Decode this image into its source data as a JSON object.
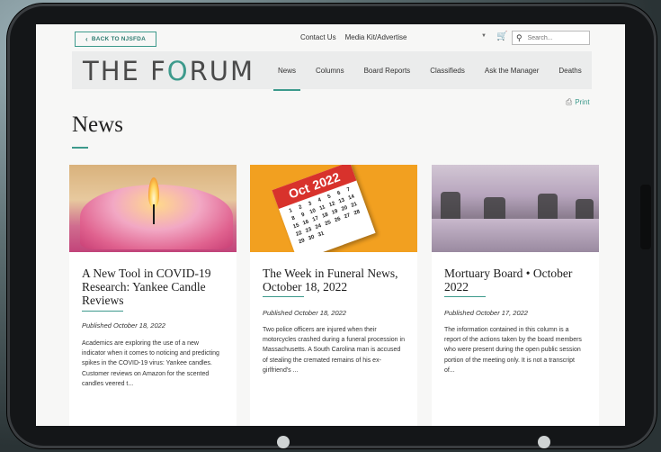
{
  "topbar": {
    "back_label": "BACK TO NJSFDA",
    "links": [
      "Contact Us",
      "Media Kit/Advertise"
    ],
    "search_placeholder": "Search..."
  },
  "header": {
    "logo_pre": "THE F",
    "logo_o": "O",
    "logo_post": "RUM",
    "nav": [
      "News",
      "Columns",
      "Board Reports",
      "Classifieds",
      "Ask the Manager",
      "Deaths"
    ],
    "active": "News"
  },
  "print_label": "Print",
  "page_title": "News",
  "cards": [
    {
      "title": "A New Tool in COVID-19 Research: Yankee Candle Reviews",
      "published": "Published October 18, 2022",
      "excerpt": "Academics are exploring the use of a new indicator when it comes to noticing and predicting spikes in the COVID-19 virus: Yankee candles. Customer reviews on Amazon for the scented candles veered t..."
    },
    {
      "title": "The Week in Funeral News, October 18, 2022",
      "published": "Published October 18, 2022",
      "excerpt": "Two police officers are injured when their motorcycles crashed during a funeral procession in Massachusetts. A South Carolina man is accused of stealing the cremated remains of his ex-girlfriend's ...",
      "calendar_month": "Oct",
      "calendar_year": "2022"
    },
    {
      "title": "Mortuary Board • October 2022",
      "published": "Published October 17, 2022",
      "excerpt": "The information contained in this column is a report of the actions taken by the board members who were present during the open public session portion of the meeting only. It is not a transcript of..."
    }
  ],
  "colors": {
    "accent": "#3d9a8c",
    "calendar_red": "#d8322c",
    "calendar_bg": "#f2a020"
  }
}
